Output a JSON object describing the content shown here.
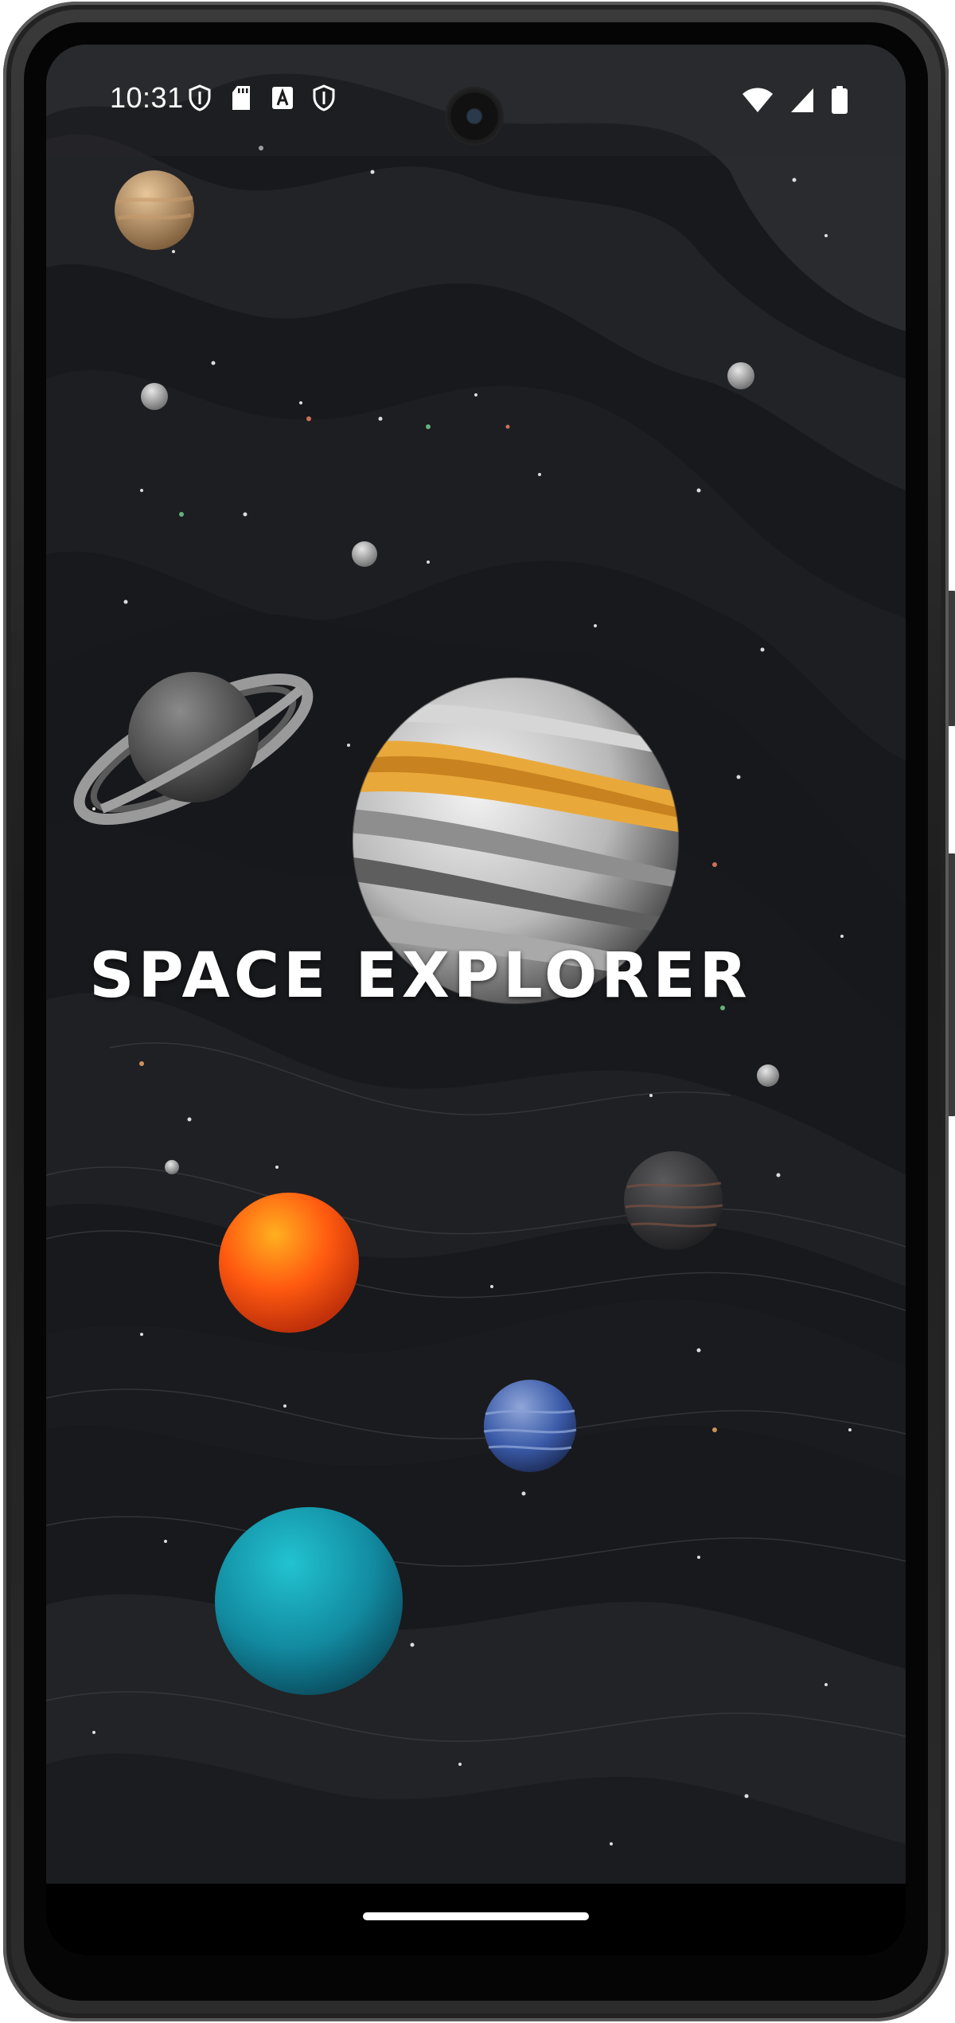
{
  "status_bar": {
    "time": "10:31",
    "left_icons": [
      "shield-icon",
      "sd-card-icon",
      "font-a-icon",
      "shield-icon"
    ],
    "right_icons": [
      "wifi-icon",
      "cell-signal-icon",
      "battery-icon"
    ]
  },
  "app": {
    "title": "SPACE EXPLORER"
  },
  "nav_bar": {
    "handle": "home-gesture-handle"
  },
  "colors": {
    "background": "#141518",
    "accent_orange": "#ff6a1a",
    "accent_teal": "#14a2b8",
    "accent_blue": "#3a5aa8",
    "title_text": "#ffffff"
  }
}
